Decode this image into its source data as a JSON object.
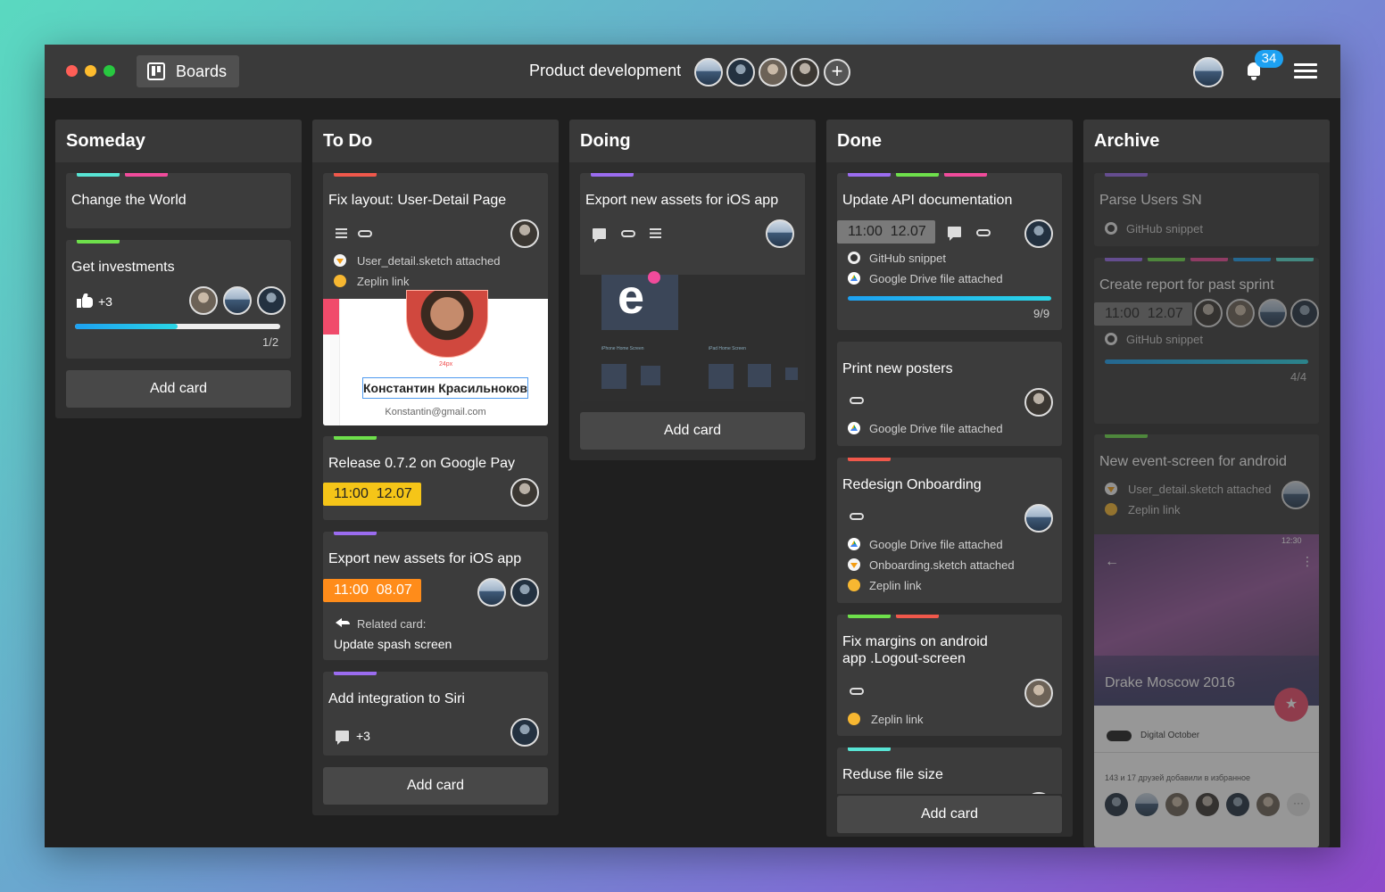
{
  "window": {
    "title": "Boards",
    "board_title": "Product development",
    "notifications_count": "34"
  },
  "colors": {
    "label_green": "#6ee04b",
    "label_cyan": "#58e4d4",
    "label_pink": "#f04b9b",
    "label_red": "#f0584b",
    "label_purple": "#9b6cf0",
    "label_blue": "#1da1f2",
    "date_yellow": "#f5c518",
    "date_orange": "#ff8c1a",
    "date_gray": "#7a7a7a"
  },
  "icons": [
    "boards-icon",
    "bell-icon",
    "menu-icon",
    "add-member-icon",
    "thumb-up-icon",
    "comment-icon",
    "attachment-icon",
    "description-icon",
    "reply-icon",
    "sketch-icon",
    "zeplin-icon",
    "google-drive-icon",
    "github-icon"
  ],
  "add_card_label": "Add card",
  "columns": [
    {
      "title": "Someday",
      "cards": [
        {
          "title": "Change the World"
        },
        {
          "title": "Get investments",
          "likes": "+3",
          "progress_text": "1/2",
          "progress": 0.5
        }
      ]
    },
    {
      "title": "To Do",
      "cards": [
        {
          "title": "Fix layout: User-Detail Page",
          "attachments": [
            "User_detail.sketch attached",
            "Zeplin link"
          ],
          "preview": {
            "name": "Константин Красильноков",
            "email": "Konstantin@gmail.com",
            "spacing": "24px"
          }
        },
        {
          "title": "Release 0.7.2 on Google Pay",
          "time": "11:00",
          "date": "12.07"
        },
        {
          "title": "Export new assets for iOS app",
          "time": "11:00",
          "date": "08.07",
          "related_label": "Related card:",
          "related_title": "Update spash screen"
        },
        {
          "title": "Add integration to Siri",
          "comments": "+3"
        }
      ]
    },
    {
      "title": "Doing",
      "cards": [
        {
          "title": "Export new assets for iOS app",
          "preview_labels": [
            "iPhone Home Screen",
            "iPad Home Screen"
          ],
          "preview_letter": "e"
        }
      ]
    },
    {
      "title": "Done",
      "cards": [
        {
          "title": "Update API documentation",
          "time": "11:00",
          "date": "12.07",
          "attachments": [
            "GitHub snippet",
            "Google Drive file attached"
          ],
          "progress_text": "9/9",
          "progress": 1.0
        },
        {
          "title": "Print new posters",
          "attachments": [
            "Google Drive file attached"
          ]
        },
        {
          "title": "Redesign Onboarding",
          "attachments": [
            "Google Drive file attached",
            "Onboarding.sketch attached",
            "Zeplin link"
          ]
        },
        {
          "title_line1": "Fix margins on android",
          "title_line2": "app .Logout-screen",
          "attachments": [
            "Zeplin link"
          ]
        },
        {
          "title": "Reduse file size"
        }
      ]
    },
    {
      "title": "Archive",
      "cards": [
        {
          "title": "Parse Users SN",
          "attachments": [
            "GitHub snippet"
          ]
        },
        {
          "title": "Create report for past sprint",
          "time": "11:00",
          "date": "12.07",
          "attachments": [
            "GitHub snippet"
          ],
          "progress_text": "4/4",
          "progress": 1.0
        },
        {
          "title": "New event-screen for android",
          "attachments": [
            "User_detail.sketch attached",
            "Zeplin link"
          ],
          "preview": {
            "time": "12:30",
            "event": "Drake Moscow 2016",
            "org": "Digital October",
            "friends": "143 и 17 друзей добавили в избранное"
          }
        }
      ]
    }
  ]
}
